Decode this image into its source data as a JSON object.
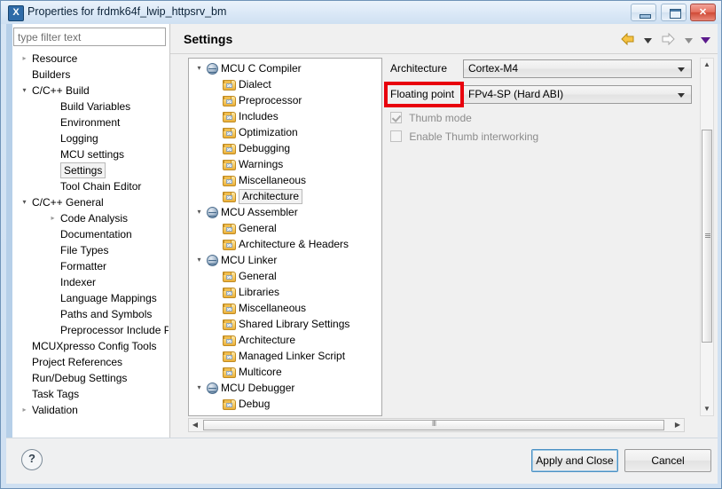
{
  "window": {
    "title": "Properties for frdmk64f_lwip_httpsrv_bm",
    "icon_name": "eclipse-x-icon",
    "icon_glyph": "X",
    "buttons": {
      "minimize": "minimize",
      "maximize": "maximize",
      "close": "✕"
    }
  },
  "filter": {
    "placeholder": "type filter text",
    "value": ""
  },
  "left_tree": {
    "items": [
      {
        "label": "Resource",
        "indent": 0,
        "arrow": "collapsed",
        "selected": false
      },
      {
        "label": "Builders",
        "indent": 0,
        "arrow": "none",
        "selected": false
      },
      {
        "label": "C/C++ Build",
        "indent": 0,
        "arrow": "expanded",
        "selected": false
      },
      {
        "label": "Build Variables",
        "indent": 1,
        "arrow": "none",
        "selected": false
      },
      {
        "label": "Environment",
        "indent": 1,
        "arrow": "none",
        "selected": false
      },
      {
        "label": "Logging",
        "indent": 1,
        "arrow": "none",
        "selected": false
      },
      {
        "label": "MCU settings",
        "indent": 1,
        "arrow": "none",
        "selected": false
      },
      {
        "label": "Settings",
        "indent": 1,
        "arrow": "none",
        "selected": true
      },
      {
        "label": "Tool Chain Editor",
        "indent": 1,
        "arrow": "none",
        "selected": false
      },
      {
        "label": "C/C++ General",
        "indent": 0,
        "arrow": "expanded",
        "selected": false
      },
      {
        "label": "Code Analysis",
        "indent": 1,
        "arrow": "collapsed",
        "selected": false
      },
      {
        "label": "Documentation",
        "indent": 1,
        "arrow": "none",
        "selected": false
      },
      {
        "label": "File Types",
        "indent": 1,
        "arrow": "none",
        "selected": false
      },
      {
        "label": "Formatter",
        "indent": 1,
        "arrow": "none",
        "selected": false
      },
      {
        "label": "Indexer",
        "indent": 1,
        "arrow": "none",
        "selected": false
      },
      {
        "label": "Language Mappings",
        "indent": 1,
        "arrow": "none",
        "selected": false
      },
      {
        "label": "Paths and Symbols",
        "indent": 1,
        "arrow": "none",
        "selected": false
      },
      {
        "label": "Preprocessor Include Pa",
        "indent": 1,
        "arrow": "none",
        "selected": false
      },
      {
        "label": "MCUXpresso Config Tools",
        "indent": 0,
        "arrow": "none",
        "selected": false
      },
      {
        "label": "Project References",
        "indent": 0,
        "arrow": "none",
        "selected": false
      },
      {
        "label": "Run/Debug Settings",
        "indent": 0,
        "arrow": "none",
        "selected": false
      },
      {
        "label": "Task Tags",
        "indent": 0,
        "arrow": "none",
        "selected": false
      },
      {
        "label": "Validation",
        "indent": 0,
        "arrow": "collapsed",
        "selected": false
      }
    ]
  },
  "page": {
    "title": "Settings",
    "nav": {
      "back_icon": "back-arrow-icon",
      "back_menu_icon": "chevron-down-icon",
      "forward_icon": "forward-arrow-icon",
      "forward_menu_icon": "chevron-down-icon",
      "view_menu_icon": "chevron-down-icon"
    }
  },
  "settings_tree": {
    "items": [
      {
        "label": "MCU C Compiler",
        "indent": 0,
        "arrow": "expanded",
        "icon": "tool-globe-icon",
        "selected": false
      },
      {
        "label": "Dialect",
        "indent": 1,
        "arrow": "none",
        "icon": "folder-icon",
        "selected": false
      },
      {
        "label": "Preprocessor",
        "indent": 1,
        "arrow": "none",
        "icon": "folder-icon",
        "selected": false
      },
      {
        "label": "Includes",
        "indent": 1,
        "arrow": "none",
        "icon": "folder-icon",
        "selected": false
      },
      {
        "label": "Optimization",
        "indent": 1,
        "arrow": "none",
        "icon": "folder-icon",
        "selected": false
      },
      {
        "label": "Debugging",
        "indent": 1,
        "arrow": "none",
        "icon": "folder-icon",
        "selected": false
      },
      {
        "label": "Warnings",
        "indent": 1,
        "arrow": "none",
        "icon": "folder-icon",
        "selected": false
      },
      {
        "label": "Miscellaneous",
        "indent": 1,
        "arrow": "none",
        "icon": "folder-icon",
        "selected": false
      },
      {
        "label": "Architecture",
        "indent": 1,
        "arrow": "none",
        "icon": "folder-icon",
        "selected": true
      },
      {
        "label": "MCU Assembler",
        "indent": 0,
        "arrow": "expanded",
        "icon": "tool-globe-icon",
        "selected": false
      },
      {
        "label": "General",
        "indent": 1,
        "arrow": "none",
        "icon": "folder-icon",
        "selected": false
      },
      {
        "label": "Architecture & Headers",
        "indent": 1,
        "arrow": "none",
        "icon": "folder-icon",
        "selected": false
      },
      {
        "label": "MCU Linker",
        "indent": 0,
        "arrow": "expanded",
        "icon": "tool-globe-icon",
        "selected": false
      },
      {
        "label": "General",
        "indent": 1,
        "arrow": "none",
        "icon": "folder-icon",
        "selected": false
      },
      {
        "label": "Libraries",
        "indent": 1,
        "arrow": "none",
        "icon": "folder-icon",
        "selected": false
      },
      {
        "label": "Miscellaneous",
        "indent": 1,
        "arrow": "none",
        "icon": "folder-icon",
        "selected": false
      },
      {
        "label": "Shared Library Settings",
        "indent": 1,
        "arrow": "none",
        "icon": "folder-icon",
        "selected": false
      },
      {
        "label": "Architecture",
        "indent": 1,
        "arrow": "none",
        "icon": "folder-icon",
        "selected": false
      },
      {
        "label": "Managed Linker Script",
        "indent": 1,
        "arrow": "none",
        "icon": "folder-icon",
        "selected": false
      },
      {
        "label": "Multicore",
        "indent": 1,
        "arrow": "none",
        "icon": "folder-icon",
        "selected": false
      },
      {
        "label": "MCU Debugger",
        "indent": 0,
        "arrow": "expanded",
        "icon": "tool-globe-icon",
        "selected": false
      },
      {
        "label": "Debug",
        "indent": 1,
        "arrow": "none",
        "icon": "folder-icon",
        "selected": false
      }
    ]
  },
  "form": {
    "architecture": {
      "label": "Architecture",
      "value": "Cortex-M4"
    },
    "floating_point": {
      "label": "Floating point",
      "value": "FPv4-SP (Hard ABI)",
      "highlighted": true,
      "highlight_color": "#e8000d"
    },
    "thumb_mode": {
      "label": "Thumb mode",
      "checked": true,
      "enabled": false
    },
    "thumb_interworking": {
      "label": "Enable Thumb interworking",
      "checked": false,
      "enabled": false
    }
  },
  "footer": {
    "help_label": "?",
    "apply_label": "Apply and Close",
    "cancel_label": "Cancel"
  }
}
